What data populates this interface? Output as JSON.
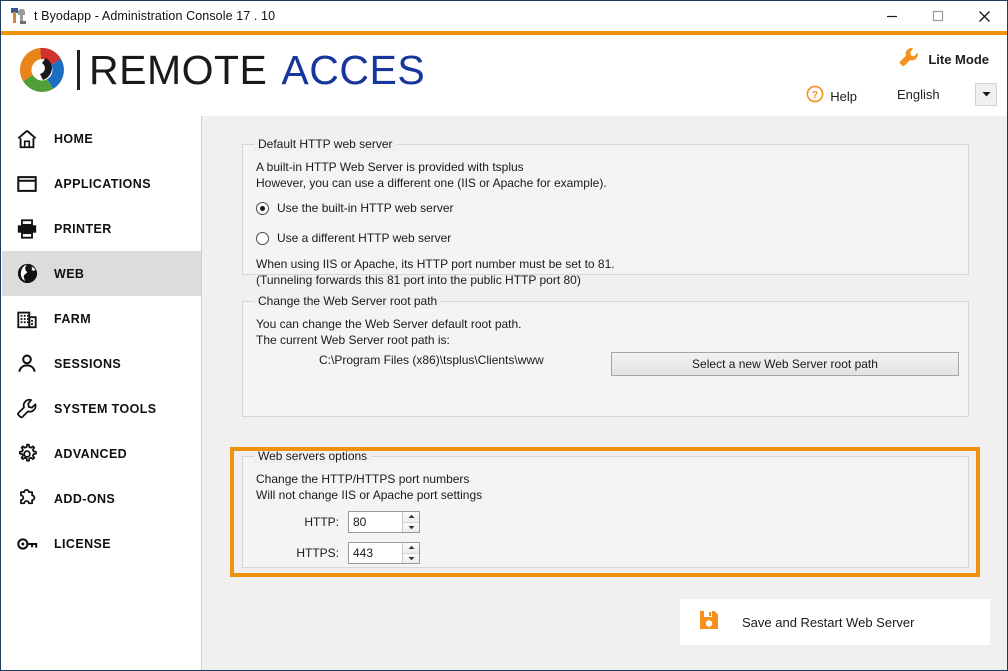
{
  "window": {
    "title": "t Byodapp - Administration Console 17 . 10",
    "icon": "app-tools-icon",
    "minimize_label": "Minimize",
    "maximize_label": "Maximize",
    "close_label": "Close",
    "accent_color": "#F0920B",
    "border_color": "#1f3a5f"
  },
  "brand": {
    "logo_icon": "remote-access-swirl-logo",
    "name_primary": "REMOTE",
    "name_secondary": "ACCES",
    "primary_color": "#1a1a1a",
    "secondary_color": "#16369c",
    "lite_mode": {
      "icon": "wrench-icon",
      "label": "Lite Mode"
    },
    "help": {
      "icon": "question-circle-icon",
      "label": "Help"
    },
    "language": {
      "value": "English",
      "arrow_icon": "chevron-down-icon"
    }
  },
  "sidebar": {
    "items": [
      {
        "label": "HOME",
        "icon": "home-icon",
        "active": false
      },
      {
        "label": "APPLICATIONS",
        "icon": "window-icon",
        "active": false
      },
      {
        "label": "PRINTER",
        "icon": "printer-icon",
        "active": false
      },
      {
        "label": "WEB",
        "icon": "globe-icon",
        "active": true
      },
      {
        "label": "FARM",
        "icon": "building-icon",
        "active": false
      },
      {
        "label": "SESSIONS",
        "icon": "user-icon",
        "active": false
      },
      {
        "label": "SYSTEM TOOLS",
        "icon": "wrench-icon",
        "active": false
      },
      {
        "label": "ADVANCED",
        "icon": "gear-icon",
        "active": false
      },
      {
        "label": "ADD-ONS",
        "icon": "puzzle-piece-icon",
        "active": false
      },
      {
        "label": "LICENSE",
        "icon": "key-icon",
        "active": false
      }
    ]
  },
  "main": {
    "default_http": {
      "title": "Default HTTP web server",
      "line1": "A built-in HTTP Web Server is provided with tsplus",
      "line2": "However, you can use a different one (IIS or Apache for example).",
      "radio_builtin": {
        "label": "Use the built-in HTTP web server",
        "selected": true
      },
      "radio_different": {
        "label": "Use a different HTTP web server",
        "selected": false
      },
      "note1": "When using IIS or Apache, its HTTP port number must be set to 81.",
      "note2": "(Tunneling forwards this 81 port into the public HTTP port 80)"
    },
    "root_path": {
      "title": "Change the Web Server root path",
      "line1": "You can change the Web Server default root path.",
      "line2": "The current Web Server root path is:",
      "current_path": "C:\\Program Files (x86)\\tsplus\\Clients\\www",
      "button_label": "Select a new Web Server root path"
    },
    "web_options": {
      "title": "Web servers options",
      "line1": "Change the HTTP/HTTPS port numbers",
      "line2": "Will not change IIS or Apache port settings",
      "http_label": "HTTP:",
      "http_value": "80",
      "https_label": "HTTPS:",
      "https_value": "443",
      "highlighted": true,
      "highlight_color": "#F0920B"
    },
    "save_button": {
      "label": "Save and Restart Web Server",
      "icon": "floppy-save-icon",
      "icon_color": "#F5921E"
    }
  }
}
